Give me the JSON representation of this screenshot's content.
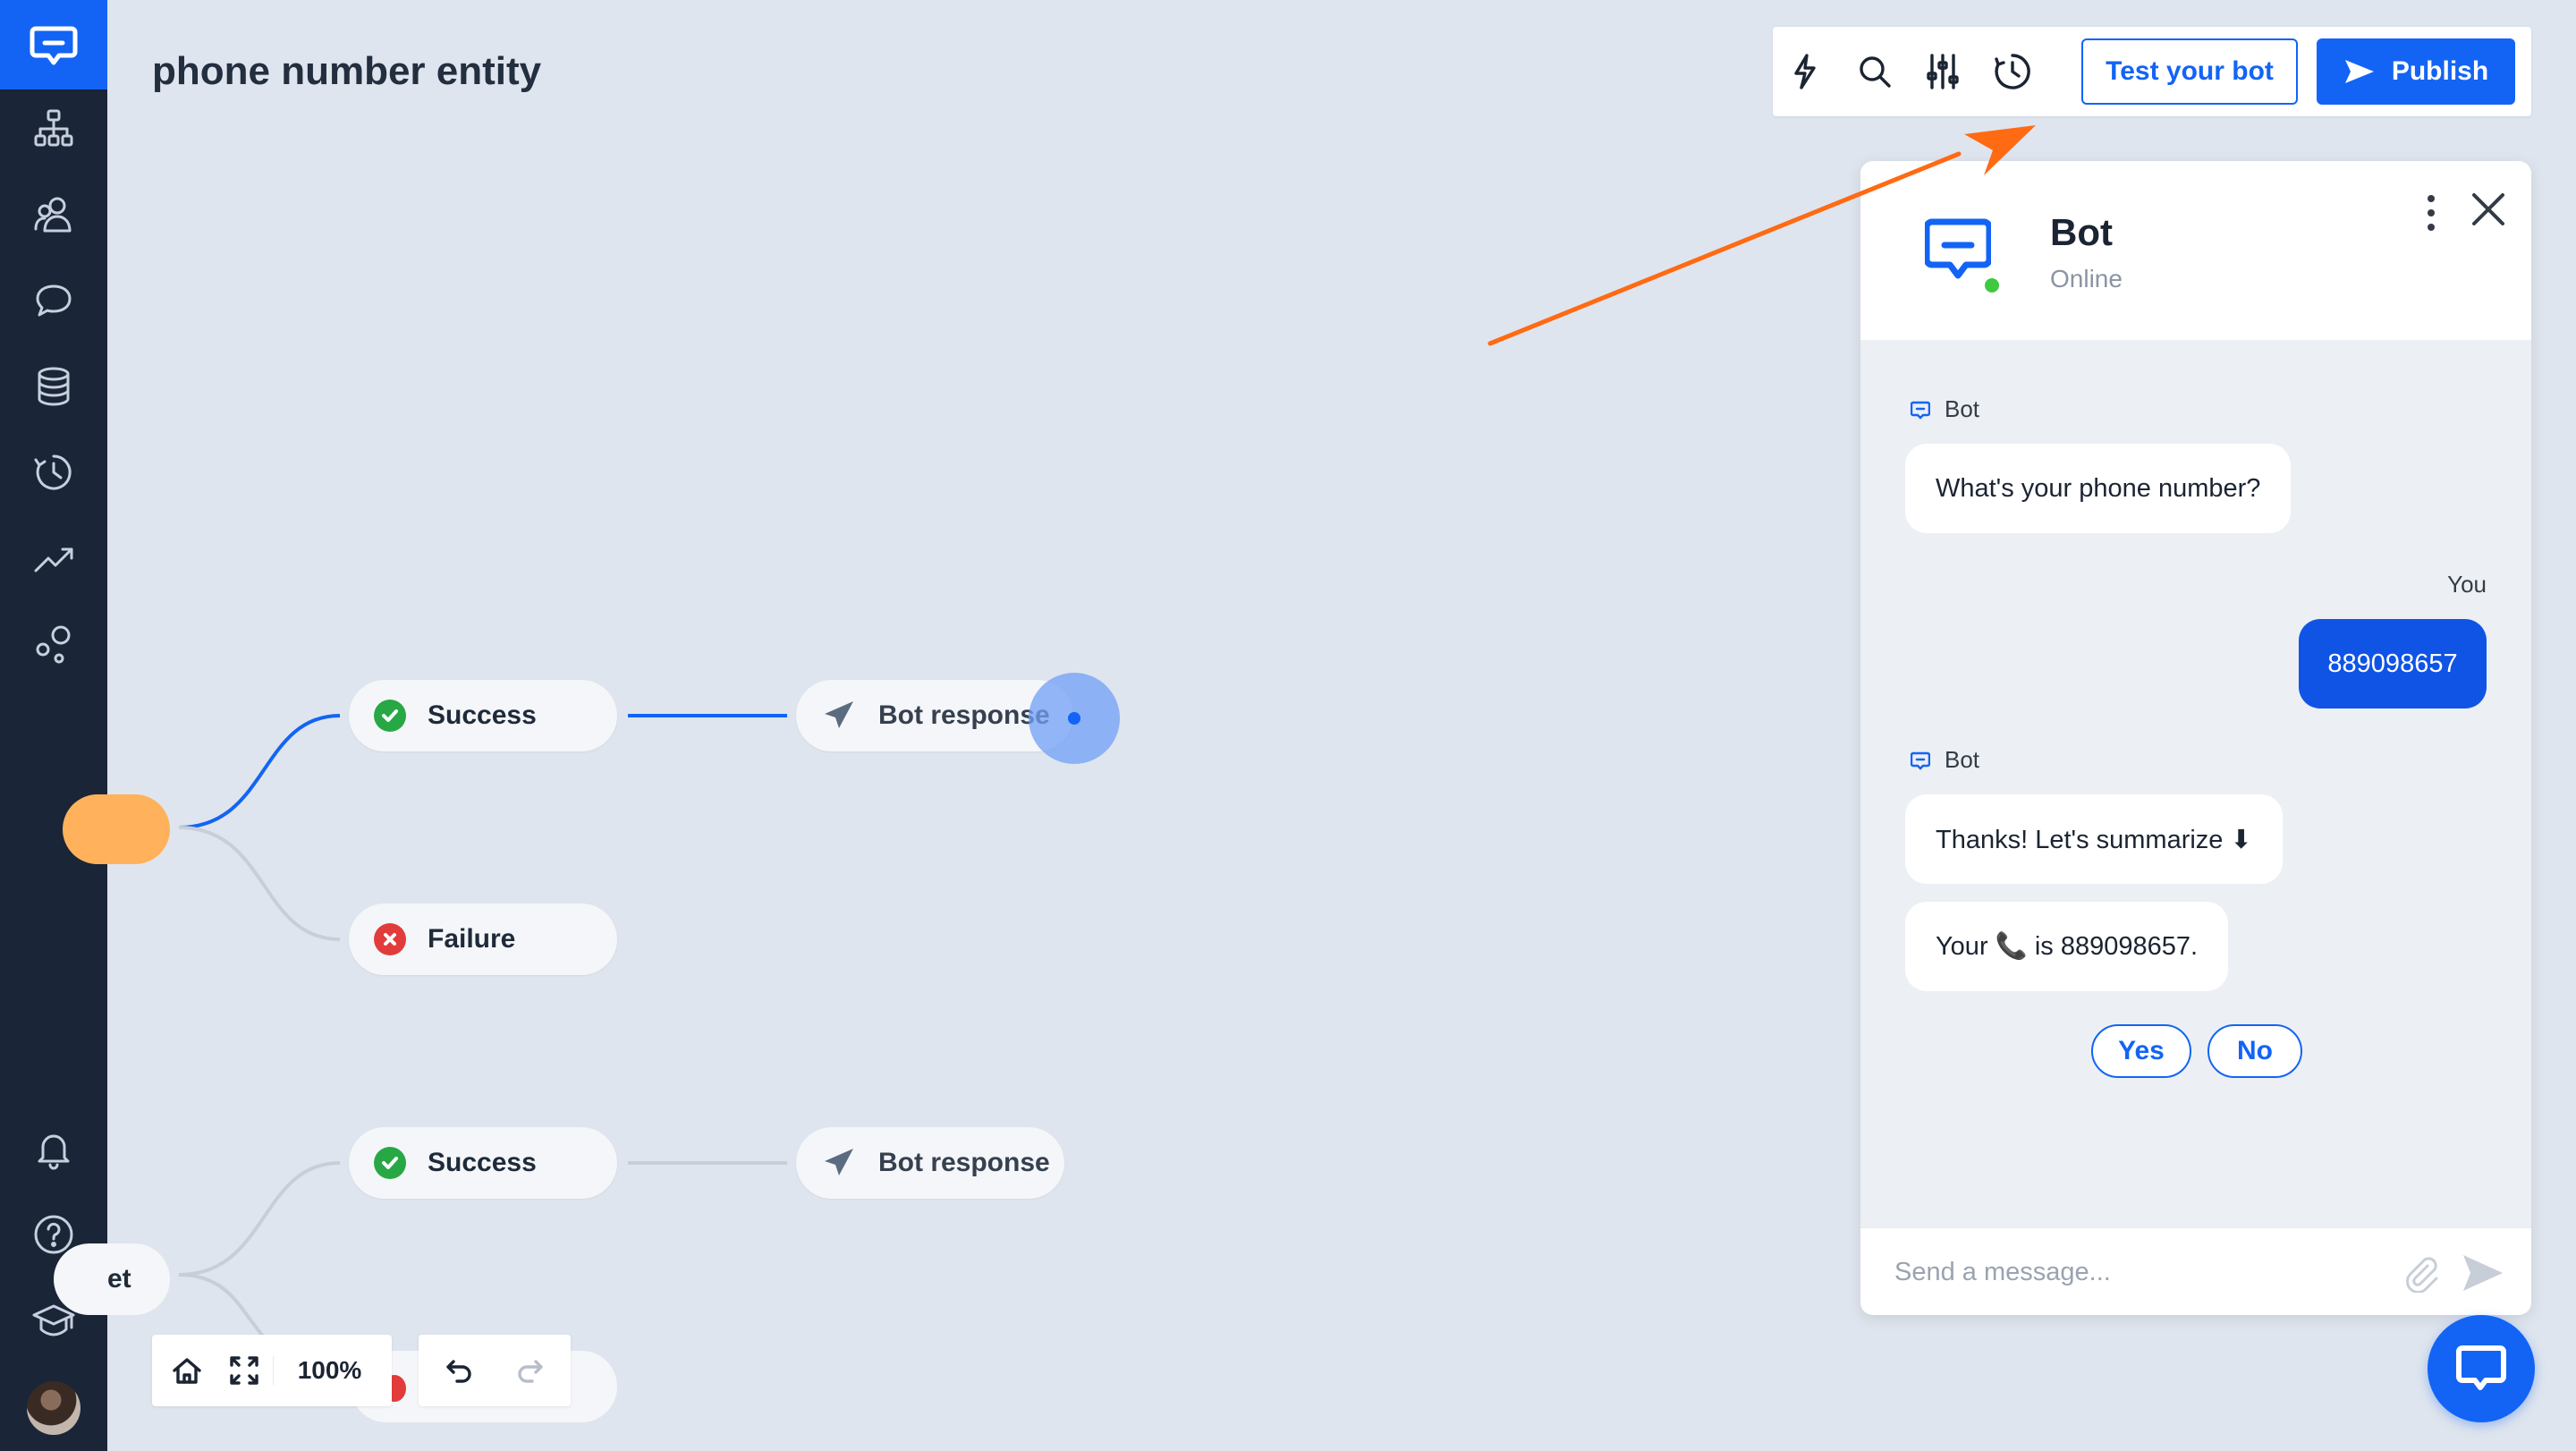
{
  "page": {
    "title": "phone number entity"
  },
  "toolbar": {
    "icons": [
      "lightning-icon",
      "search-icon",
      "sliders-icon",
      "history-icon"
    ],
    "test_label": "Test your bot",
    "publish_label": "Publish"
  },
  "sidebar": {
    "items": [
      {
        "name": "flow-icon"
      },
      {
        "name": "users-icon"
      },
      {
        "name": "chat-bubbles-icon"
      },
      {
        "name": "database-icon"
      },
      {
        "name": "history-icon"
      },
      {
        "name": "analytics-icon"
      },
      {
        "name": "integrations-icon"
      },
      {
        "name": "bell-icon"
      },
      {
        "name": "help-icon"
      },
      {
        "name": "academy-icon"
      }
    ]
  },
  "canvas": {
    "nodes": {
      "success_1": "Success",
      "failure_1": "Failure",
      "bot_response_1": "Bot response",
      "success_2": "Success",
      "bot_response_2": "Bot response",
      "left_node_text": "et"
    },
    "zoom": "100%",
    "colors": {
      "active_line": "#1364f5",
      "inactive_line": "#c9ced6",
      "entry_node": "#ffb25b"
    }
  },
  "chat": {
    "bot_name": "Bot",
    "status": "Online",
    "messages": [
      {
        "sender": "Bot",
        "text": "What's your phone number?"
      },
      {
        "sender": "You",
        "text": "889098657"
      },
      {
        "sender": "Bot",
        "text": "Thanks! Let's summarize ⬇"
      },
      {
        "sender": "",
        "text": "Your 📞 is 889098657."
      }
    ],
    "quick_replies": [
      "Yes",
      "No"
    ],
    "input_placeholder": "Send a message...",
    "colors": {
      "user_bubble": "#1054e6",
      "online": "#3fc93f"
    }
  },
  "annotation": {
    "arrow_color": "#ff6a13"
  }
}
